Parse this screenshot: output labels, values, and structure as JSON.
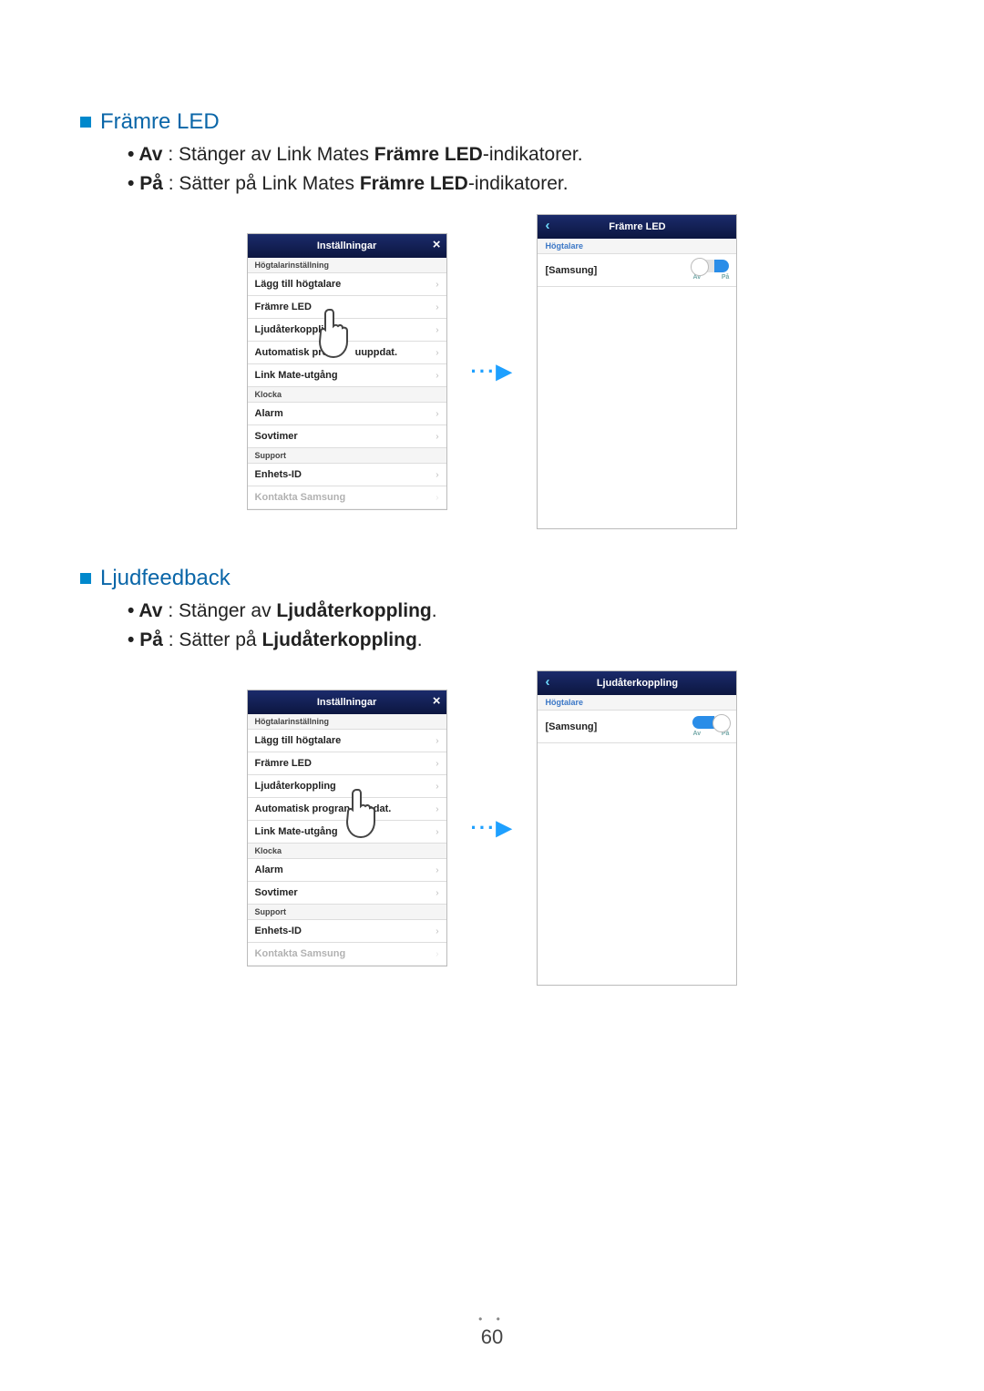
{
  "sections": {
    "front_led": {
      "title": "Främre LED",
      "items": {
        "off_label": "Av",
        "off_text1": " : Stänger av Link Mates ",
        "off_bold": "Främre LED",
        "off_text2": "-indikatorer.",
        "on_label": "På",
        "on_text1": " : Sätter på Link Mates ",
        "on_bold": "Främre LED",
        "on_text2": "-indikatorer."
      }
    },
    "sound_fb": {
      "title": "Ljudfeedback",
      "items": {
        "off_label": "Av",
        "off_text1": " : Stänger av ",
        "off_bold": "Ljudåterkoppling",
        "off_text2": ".",
        "on_label": "På",
        "on_text1": " : Sätter på ",
        "on_bold": "Ljudåterkoppling",
        "on_text2": "."
      }
    }
  },
  "panel_settings": {
    "title": "Inställningar",
    "close": "×",
    "cat_speaker": "Högtalarinställning",
    "rows": {
      "add_speaker": {
        "label": "Lägg till högtalare"
      },
      "front_led": {
        "label": "Främre LED"
      },
      "sound_fb": {
        "label": "Ljudåterkoppling"
      },
      "auto_sw1": {
        "label_a": "Automatisk progr",
        "label_b": "uuppdat."
      },
      "auto_sw2": {
        "label_a": "Automatisk progran",
        "label_b": "ppdat."
      },
      "linkmate_out": {
        "label": "Link Mate-utgång"
      }
    },
    "cat_clock": "Klocka",
    "rows2": {
      "alarm": {
        "label": "Alarm"
      },
      "sovtimer": {
        "label": "Sovtimer"
      }
    },
    "cat_support": "Support",
    "rows3": {
      "device_id": {
        "label": "Enhets-ID"
      },
      "contact": {
        "label": "Kontakta Samsung"
      }
    },
    "chevron": "›"
  },
  "panel_detail": {
    "front_led_title": "Främre LED",
    "sound_fb_title": "Ljudåterkoppling",
    "cat": "Högtalare",
    "device": "[Samsung]",
    "toggle_av": "Av",
    "toggle_pa": "På"
  },
  "arrow": "···▶",
  "page_number": "60",
  "icons": {
    "back": "‹",
    "close": "×"
  }
}
